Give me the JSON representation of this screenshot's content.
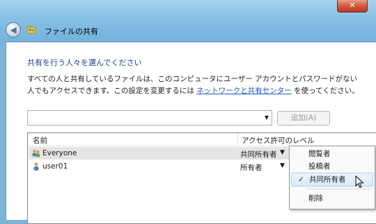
{
  "window": {
    "title": "ファイルの共有",
    "close_label": "✕"
  },
  "heading": "共有を行う人々を選んでください",
  "description": {
    "line1": "すべての人と共有しているファイルは、このコンピュータにユーザー アカウントとパスワードがない",
    "line2_pre": "人でもアクセスできます。この設定を変更するには ",
    "link": "ネットワークと共有センター",
    "line2_post": " を使ってください。"
  },
  "combo": {
    "value": "",
    "arrow": "▼"
  },
  "add_button": "追加(A)",
  "list": {
    "columns": {
      "name": "名前",
      "access": "アクセス許可のレベル"
    },
    "rows": [
      {
        "name": "Everyone",
        "permission": "共同所有者",
        "arrow": "▼"
      },
      {
        "name": "user01",
        "permission": "所有者",
        "arrow": "▼"
      }
    ]
  },
  "menu": {
    "items": [
      {
        "label": "閲覧者",
        "check": ""
      },
      {
        "label": "投稿者",
        "check": ""
      },
      {
        "label": "共同所有者",
        "check": "✓"
      },
      {
        "label": "削除",
        "check": ""
      }
    ]
  }
}
